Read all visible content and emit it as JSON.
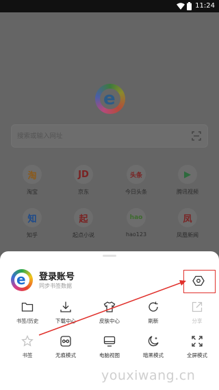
{
  "status_bar": {
    "time": "11:24"
  },
  "home": {
    "search_placeholder": "搜索或输入网址",
    "shortcuts": [
      {
        "label": "淘宝",
        "glyph": "淘"
      },
      {
        "label": "京东",
        "glyph": "JD"
      },
      {
        "label": "今日头条",
        "glyph": "头条"
      },
      {
        "label": "腾讯视频",
        "glyph": "▶"
      },
      {
        "label": "知乎",
        "glyph": "知"
      },
      {
        "label": "起点小说",
        "glyph": "起"
      },
      {
        "label": "hao123",
        "glyph": "hao"
      },
      {
        "label": "凤凰新闻",
        "glyph": "凤"
      }
    ]
  },
  "sheet": {
    "account_title": "登录账号",
    "account_subtitle": "同步书签数据",
    "menu": [
      {
        "label": "书签/历史",
        "icon": "folder-icon"
      },
      {
        "label": "下载中心",
        "icon": "download-icon"
      },
      {
        "label": "皮肤中心",
        "icon": "shirt-icon"
      },
      {
        "label": "刷新",
        "icon": "refresh-icon"
      },
      {
        "label": "分享",
        "icon": "share-icon"
      },
      {
        "label": "书签",
        "icon": "star-icon"
      },
      {
        "label": "无痕模式",
        "icon": "incognito-icon"
      },
      {
        "label": "电脑视图",
        "icon": "desktop-icon"
      },
      {
        "label": "暗黑模式",
        "icon": "moon-icon"
      },
      {
        "label": "全屏模式",
        "icon": "fullscreen-icon"
      }
    ]
  },
  "watermark": "youxiwang.cn",
  "colors": {
    "highlight": "#e0302b",
    "overlay": "#616161"
  }
}
